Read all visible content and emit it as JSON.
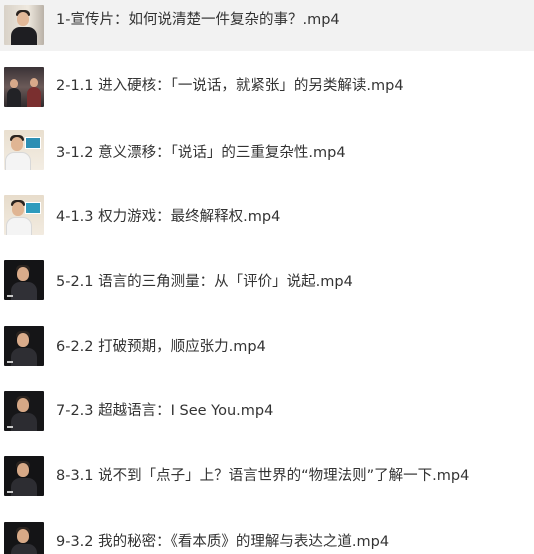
{
  "files": [
    {
      "name": "1-宣传片：如何说清楚一件复杂的事？.mp4",
      "selected": true
    },
    {
      "name": "2-1.1 进入硬核：「一说话，就紧张」的另类解读.mp4",
      "selected": false
    },
    {
      "name": "3-1.2 意义漂移：「说话」的三重复杂性.mp4",
      "selected": false
    },
    {
      "name": "4-1.3 权力游戏：最终解释权.mp4",
      "selected": false
    },
    {
      "name": "5-2.1 语言的三角测量：从「评价」说起.mp4",
      "selected": false
    },
    {
      "name": "6-2.2 打破预期，顺应张力.mp4",
      "selected": false
    },
    {
      "name": "7-2.3 超越语言：I See You.mp4",
      "selected": false
    },
    {
      "name": "8-3.1 说不到「点子」上？语言世界的“物理法则”了解一下.mp4",
      "selected": false
    },
    {
      "name": "9-3.2 我的秘密：《看本质》的理解与表达之道.mp4",
      "selected": false
    }
  ],
  "colors": {
    "text": "#333333",
    "selected_row": "#f2f2f2"
  }
}
